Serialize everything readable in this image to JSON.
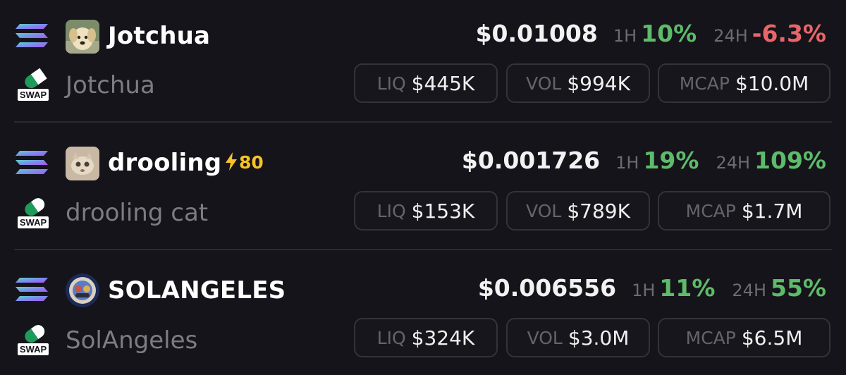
{
  "colors": {
    "background": "#15141a",
    "positive": "#5dbb6a",
    "negative": "#e8666a",
    "boost": "#f5c228",
    "muted": "#7d7c84",
    "pill_border": "#34333a"
  },
  "icons": {
    "chain": "solana-logo-icon",
    "dex": "swap-icon",
    "boost": "lightning-bolt-icon"
  },
  "tokens": [
    {
      "symbol": "Jotchua",
      "name": "Jotchua",
      "avatar": "dog-avatar",
      "boost": "",
      "price": "$0.01008",
      "change_1h_label": "1H",
      "change_1h": "10%",
      "change_24h_label": "24H",
      "change_24h": "-6.3%",
      "liq_label": "LIQ",
      "liq": "$445K",
      "vol_label": "VOL",
      "vol": "$994K",
      "mcap_label": "MCAP",
      "mcap": "$10.0M"
    },
    {
      "symbol": "drooling",
      "name": "drooling cat",
      "avatar": "cat-avatar",
      "boost": "80",
      "price": "$0.001726",
      "change_1h_label": "1H",
      "change_1h": "19%",
      "change_24h_label": "24H",
      "change_24h": "109%",
      "liq_label": "LIQ",
      "liq": "$153K",
      "vol_label": "VOL",
      "vol": "$789K",
      "mcap_label": "MCAP",
      "mcap": "$1.7M"
    },
    {
      "symbol": "SOLANGELES",
      "name": "SolAngeles",
      "avatar": "badge-avatar",
      "boost": "",
      "price": "$0.006556",
      "change_1h_label": "1H",
      "change_1h": "11%",
      "change_24h_label": "24H",
      "change_24h": "55%",
      "liq_label": "LIQ",
      "liq": "$324K",
      "vol_label": "VOL",
      "vol": "$3.0M",
      "mcap_label": "MCAP",
      "mcap": "$6.5M"
    }
  ]
}
